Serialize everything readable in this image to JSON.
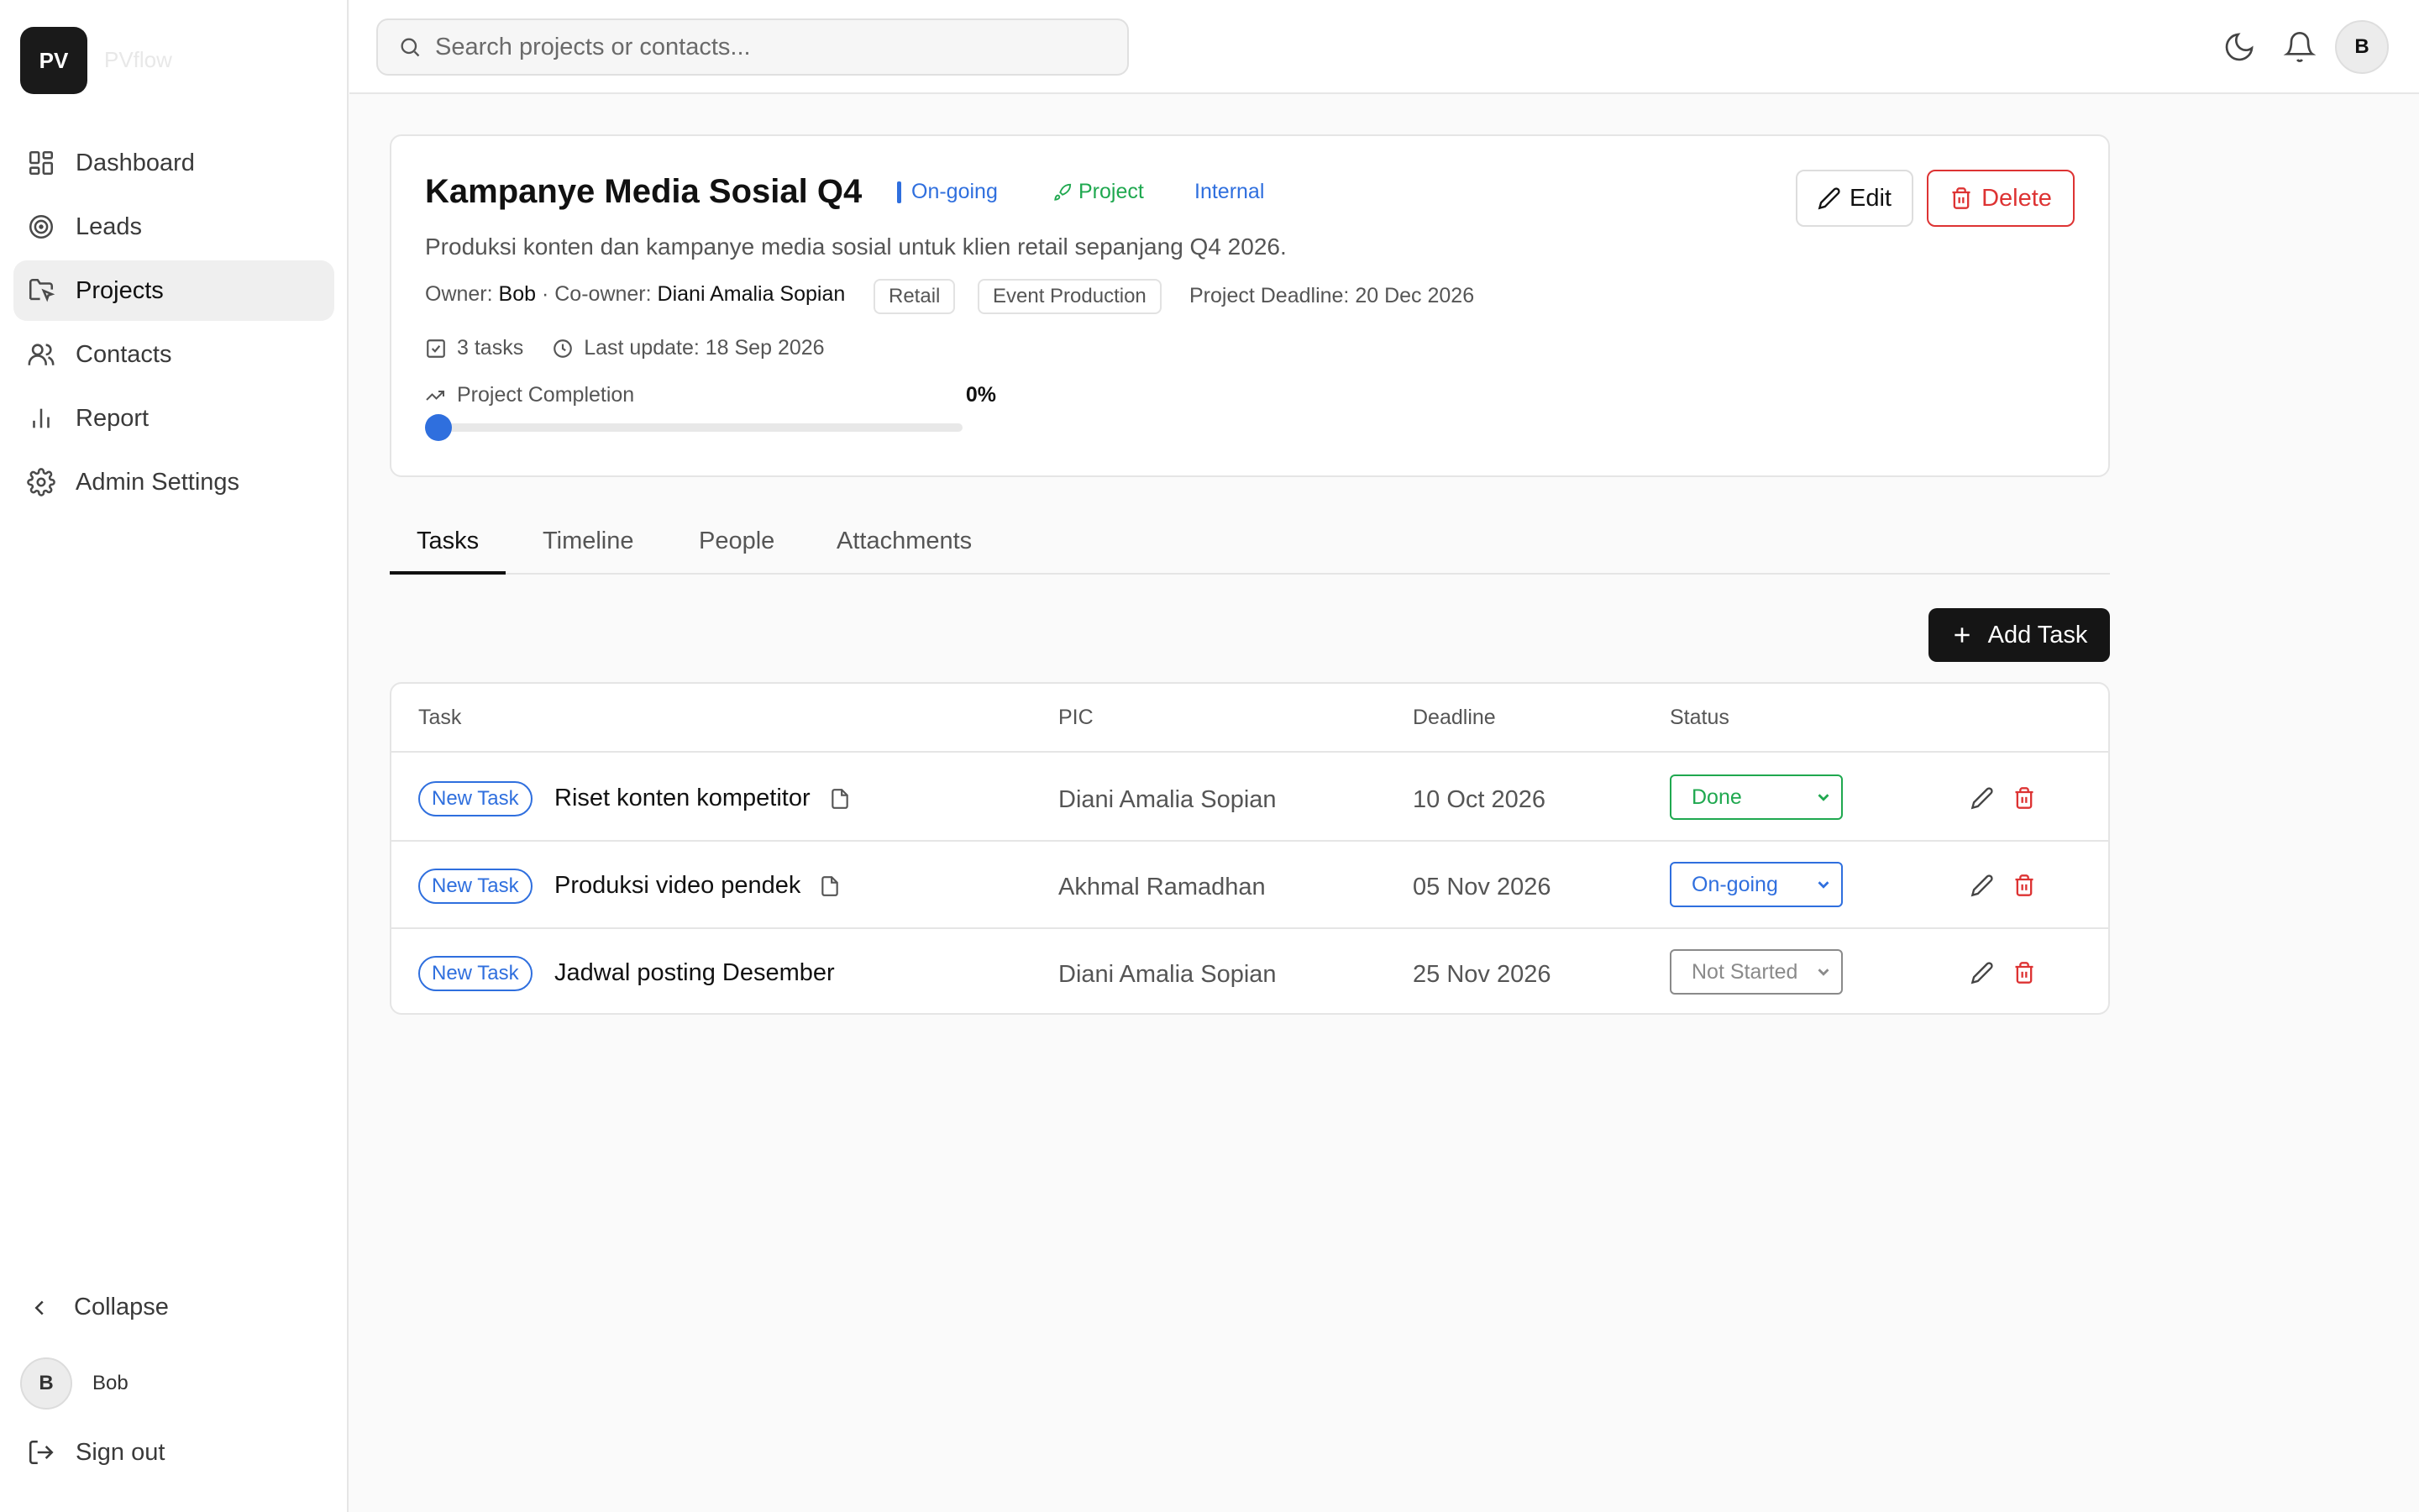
{
  "app": {
    "logo_initials": "PV",
    "logo_name": "PVflow"
  },
  "sidebar": {
    "items": [
      {
        "label": "Dashboard",
        "icon": "dashboard-icon"
      },
      {
        "label": "Leads",
        "icon": "target-icon"
      },
      {
        "label": "Projects",
        "icon": "folder-icon",
        "active": true
      },
      {
        "label": "Contacts",
        "icon": "users-icon"
      },
      {
        "label": "Report",
        "icon": "bar-chart-icon"
      },
      {
        "label": "Admin Settings",
        "icon": "gear-icon"
      }
    ],
    "collapse_label": "Collapse",
    "user": {
      "initial": "B",
      "name": "Bob"
    },
    "signout_label": "Sign out"
  },
  "topbar": {
    "search_placeholder": "Search projects or contacts...",
    "avatar_initial": "B"
  },
  "project": {
    "title": "Kampanye Media Sosial Q4",
    "status_badge": "On-going",
    "type_badge": "Project",
    "scope_badge": "Internal",
    "description": "Produksi konten dan kampanye media sosial untuk klien retail sepanjang Q4 2026.",
    "owner_label": "Owner:",
    "owner": "Bob",
    "coowner_label": "· Co-owner:",
    "coowner": "Diani Amalia Sopian",
    "tags": [
      "Retail",
      "Event Production"
    ],
    "deadline": "Project Deadline: 20 Dec 2026",
    "tasks_count": "3 tasks",
    "last_update": "Last update: 18 Sep 2026",
    "completion_label": "Project Completion",
    "completion_pct": "0%",
    "completion_value": 0,
    "edit_label": "Edit",
    "delete_label": "Delete"
  },
  "tabs": [
    "Tasks",
    "Timeline",
    "People",
    "Attachments"
  ],
  "add_task_label": "Add Task",
  "table": {
    "headers": [
      "Task",
      "PIC",
      "Deadline",
      "Status"
    ],
    "rows": [
      {
        "badge": "New Task",
        "name": "Riset konten kompetitor",
        "has_file": true,
        "pic": "Diani Amalia Sopian",
        "deadline": "10 Oct 2026",
        "status": "Done",
        "status_color": "#1fa84f"
      },
      {
        "badge": "New Task",
        "name": "Produksi video pendek",
        "has_file": true,
        "pic": "Akhmal Ramadhan",
        "deadline": "05 Nov 2026",
        "status": "On-going",
        "status_color": "#2f6fde"
      },
      {
        "badge": "New Task",
        "name": "Jadwal posting Desember",
        "has_file": false,
        "pic": "Diani Amalia Sopian",
        "deadline": "25 Nov 2026",
        "status": "Not Started",
        "status_color": "#8a8a8a"
      }
    ]
  },
  "colors": {
    "accent": "#2f6fde",
    "danger": "#d33333",
    "success": "#1fa84f",
    "dark": "#151515"
  }
}
